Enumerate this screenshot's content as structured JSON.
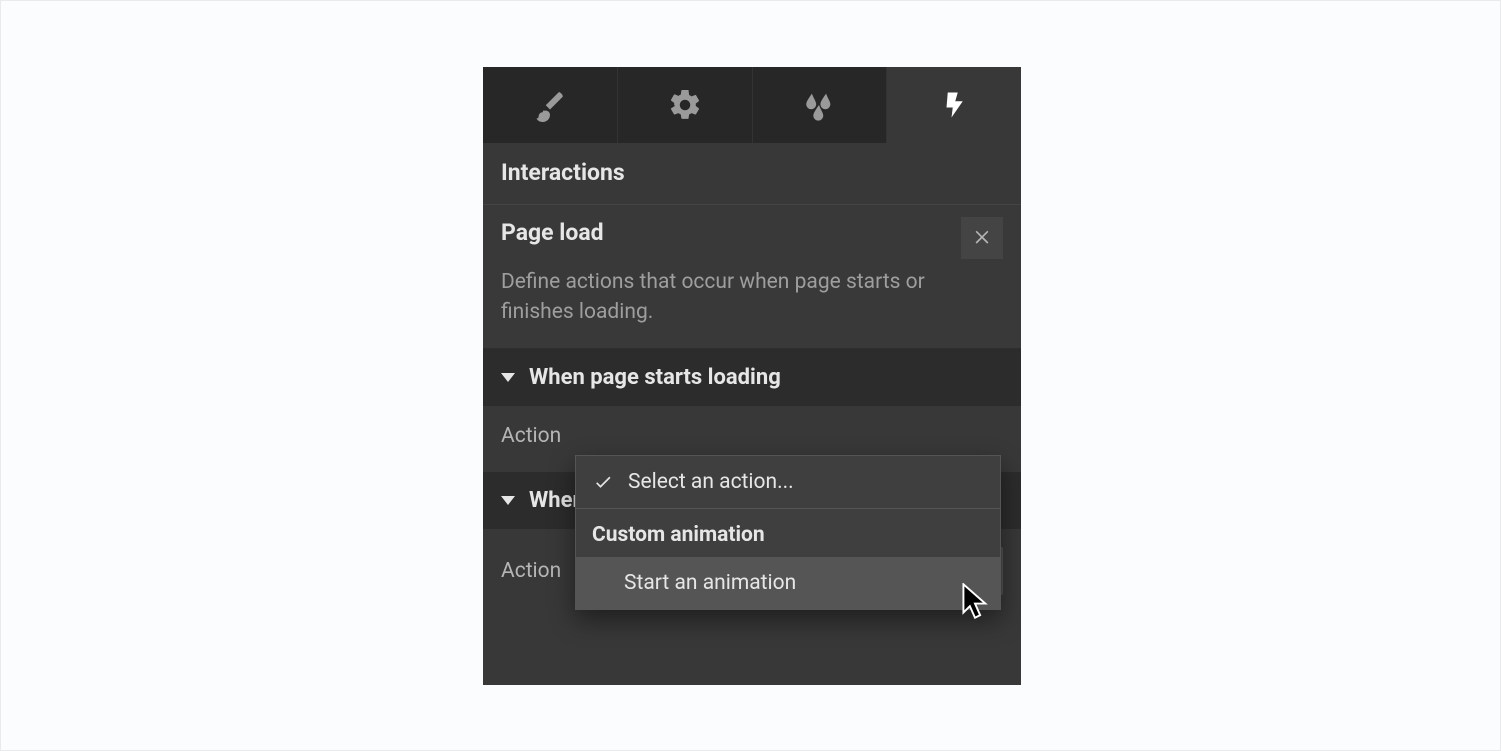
{
  "panel": {
    "heading": "Interactions"
  },
  "tabs": [
    "style",
    "settings",
    "effects",
    "interactions"
  ],
  "activeTab": "interactions",
  "trigger": {
    "title": "Page load",
    "description": "Define actions that occur when page starts or finishes loading."
  },
  "sections": [
    {
      "title": "When page starts loading",
      "actionLabel": "Action",
      "placeholder": "Select an action..."
    },
    {
      "title": "When page finishes loading",
      "actionLabel": "Action",
      "placeholder": "Select an action..."
    }
  ],
  "dropdown": {
    "placeholder": "Select an action...",
    "group": "Custom animation",
    "options": [
      "Start an animation"
    ],
    "selected": "Select an action...",
    "hovered": "Start an animation"
  }
}
